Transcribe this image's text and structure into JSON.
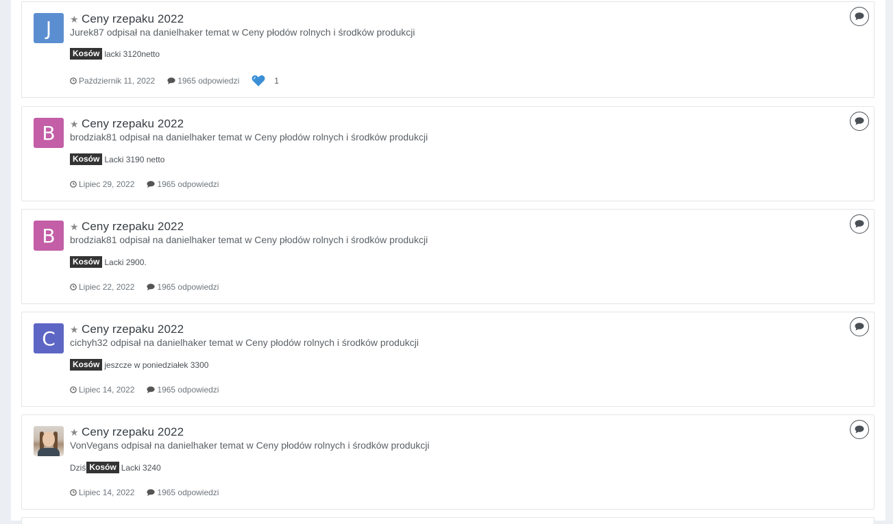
{
  "posts": [
    {
      "avatar_letter": "J",
      "avatar_color": "#5b8ed1",
      "title": "Ceny rzepaku 2022",
      "author": "Jurek87",
      "verb": "odpisał na",
      "target_user": "danielhaker",
      "temat_word": "temat w",
      "forum": "Ceny płodów rolnych i środków produkcji",
      "pre": "",
      "tag": "Kosów",
      "snippet": "lacki 3120netto",
      "date": "Październik 11, 2022",
      "replies": "1965 odpowiedzi",
      "likes": "1"
    },
    {
      "avatar_letter": "B",
      "avatar_color": "#c35ea7",
      "title": "Ceny rzepaku 2022",
      "author": "brodziak81",
      "verb": "odpisał na",
      "target_user": "danielhaker",
      "temat_word": "temat w",
      "forum": "Ceny płodów rolnych i środków produkcji",
      "pre": "",
      "tag": "Kosów",
      "snippet": "Lacki 3190 netto",
      "date": "Lipiec 29, 2022",
      "replies": "1965 odpowiedzi"
    },
    {
      "avatar_letter": "B",
      "avatar_color": "#c35ea7",
      "title": "Ceny rzepaku 2022",
      "author": "brodziak81",
      "verb": "odpisał na",
      "target_user": "danielhaker",
      "temat_word": "temat w",
      "forum": "Ceny płodów rolnych i środków produkcji",
      "pre": "",
      "tag": "Kosów",
      "snippet": "Lacki 2900.",
      "date": "Lipiec 22, 2022",
      "replies": "1965 odpowiedzi"
    },
    {
      "avatar_letter": "C",
      "avatar_color": "#5d66c4",
      "title": "Ceny rzepaku 2022",
      "author": "cichyh32",
      "verb": "odpisał na",
      "target_user": "danielhaker",
      "temat_word": "temat w",
      "forum": "Ceny płodów rolnych i środków produkcji",
      "pre": "",
      "tag": "Kosów",
      "snippet": "jeszcze w poniedziałek 3300",
      "date": "Lipiec 14, 2022",
      "replies": "1965 odpowiedzi"
    },
    {
      "avatar_letter": "",
      "avatar_color": "",
      "title": "Ceny rzepaku 2022",
      "author": "VonVegans",
      "verb": "odpisał na",
      "target_user": "danielhaker",
      "temat_word": "temat w",
      "forum": "Ceny płodów rolnych i środków produkcji",
      "pre": "Dziś",
      "tag": "Kosów",
      "snippet": "Lacki 3240",
      "date": "Lipiec 14, 2022",
      "replies": "1965 odpowiedzi"
    }
  ]
}
